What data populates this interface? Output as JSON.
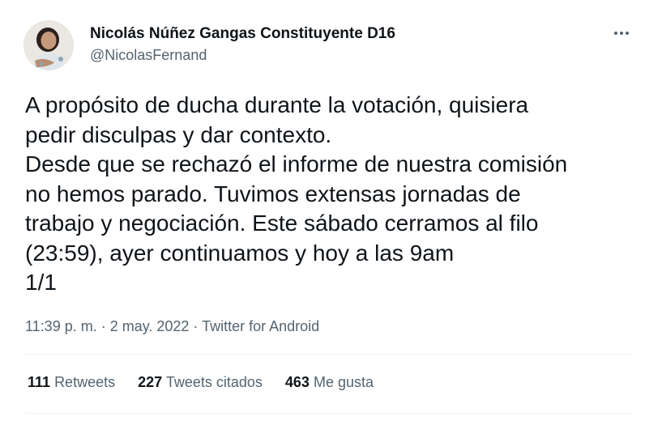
{
  "author": {
    "name": "Nicolás Núñez Gangas Constituyente D16",
    "handle": "@NicolasFernand"
  },
  "tweet": {
    "lines": [
      "A propósito de ducha durante la votación, quisiera",
      "pedir disculpas y dar contexto.",
      "Desde que se rechazó el informe de nuestra comisión",
      "no hemos parado. Tuvimos extensas jornadas de",
      "trabajo y negociación. Este sábado cerramos al filo",
      "(23:59), ayer continuamos y hoy a las 9am",
      "1/1"
    ],
    "time": "11:39 p. m.",
    "separator": " · ",
    "date": "2 may. 2022",
    "source": "Twitter for Android"
  },
  "stats": {
    "retweets": {
      "count": "111",
      "label": "Retweets"
    },
    "quotes": {
      "count": "227",
      "label": "Tweets citados"
    },
    "likes": {
      "count": "463",
      "label": "Me gusta"
    }
  },
  "icons": {
    "more": "more-options-icon",
    "avatar": "avatar"
  },
  "colors": {
    "text_primary": "#0f1419",
    "text_secondary": "#536471",
    "divider": "#eff3f4"
  }
}
